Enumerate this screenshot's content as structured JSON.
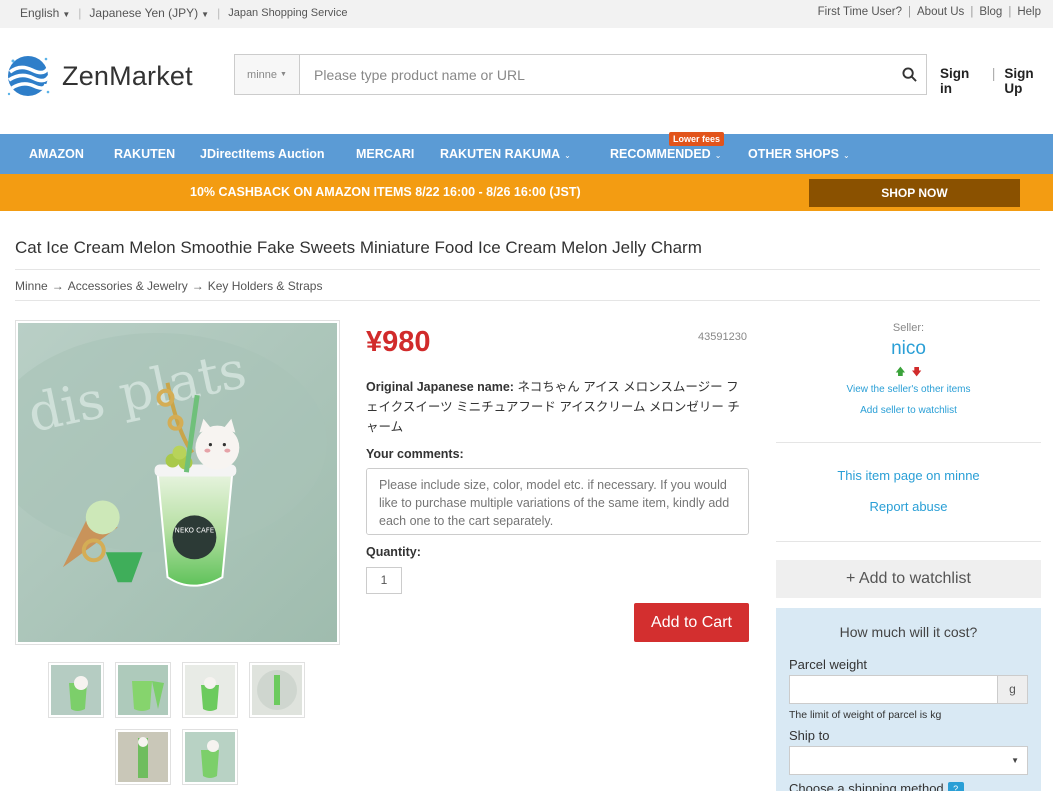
{
  "topbar": {
    "language": "English",
    "currency": "Japanese Yen (JPY)",
    "service": "Japan Shopping Service",
    "links": [
      "First Time User?",
      "About Us",
      "Blog",
      "Help"
    ]
  },
  "brand": {
    "name": "ZenMarket"
  },
  "search": {
    "shop_select": "minne",
    "placeholder": "Please type product name or URL"
  },
  "auth": {
    "sign_in": "Sign in",
    "sign_up": "Sign Up"
  },
  "nav": {
    "items": [
      "AMAZON",
      "RAKUTEN",
      "JDirectItems Auction",
      "MERCARI",
      "RAKUTEN RAKUMA",
      "RECOMMENDED",
      "OTHER SHOPS"
    ],
    "badge": "Lower fees"
  },
  "promo": {
    "text": "10% CASHBACK ON AMAZON ITEMS 8/22 16:00 - 8/26 16:00 (JST)",
    "button": "SHOP NOW"
  },
  "product": {
    "title": "Cat Ice Cream Melon Smoothie Fake Sweets Miniature Food Ice Cream Melon Jelly Charm",
    "breadcrumb": [
      "Minne",
      "Accessories & Jewelry",
      "Key Holders & Straps"
    ],
    "breadcrumb_arrow": "→",
    "price": "¥980",
    "item_id": "43591230",
    "original_name_label": "Original Japanese name:",
    "original_name": "ネコちゃん アイス メロンスムージー フェイクスイーツ ミニチュアフード アイスクリーム メロンゼリー チャーム",
    "comments_label": "Your comments:",
    "comments_placeholder": "Please include size, color, model etc. if necessary. If you would like to purchase multiple variations of the same item, kindly add each one to the cart separately.",
    "quantity_label": "Quantity:",
    "quantity": "1",
    "add_to_cart": "Add to Cart"
  },
  "seller": {
    "label": "Seller:",
    "name": "nico",
    "other_items": "View the seller's other items",
    "add_watchlist": "Add seller to watchlist",
    "item_page": "This item page on minne",
    "report": "Report abuse"
  },
  "watchlist": {
    "label": "+ Add to watchlist"
  },
  "calculator": {
    "title": "How much will it cost?",
    "weight_label": "Parcel weight",
    "unit": "g",
    "limit_text": "The limit of weight of parcel is kg",
    "ship_to_label": "Ship to",
    "method_label": "Choose a shipping method",
    "help": "?"
  },
  "colors": {
    "nav": "#5b9bd5",
    "promo": "#f39c12",
    "price": "#d12b2b",
    "cart": "#d32f2f",
    "link": "#2a9fd6"
  }
}
